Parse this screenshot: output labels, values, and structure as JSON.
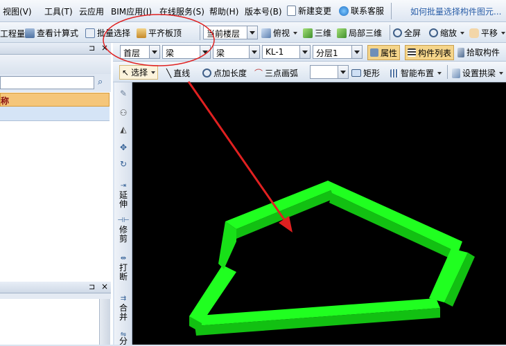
{
  "menubar": {
    "items": [
      "视图(V)",
      "工具(T)",
      "云应用",
      "BIM应用(I)",
      "在线服务(S)",
      "帮助(H)",
      "版本号(B)"
    ],
    "new_change": "新建变更",
    "support": "联系客服",
    "hint": "如何批量选择构件图元..."
  },
  "toolbar1": {
    "items": [
      "工程量",
      "查看计算式",
      "批量选择",
      "平齐板顶"
    ],
    "floor_scope": "当前楼层",
    "view_items": [
      "俯视",
      "三维",
      "局部三维",
      "全屏",
      "缩放",
      "平移"
    ]
  },
  "toolbar2": {
    "floor": "首层",
    "category": "梁",
    "type": "梁",
    "component": "KL-1",
    "sublayer": "分层1",
    "properties": "属性",
    "component_list": "构件列表",
    "pick": "拾取构件"
  },
  "toolbar3": {
    "select": "选择",
    "line": "直线",
    "point_length": "点加长度",
    "arc": "三点画弧",
    "rect": "矩形",
    "smart_layout": "智能布置",
    "set_arch_beam": "设置拱梁"
  },
  "leftpanel": {
    "name_column": "称",
    "pin_symbol": "⊐",
    "close_symbol": "×"
  },
  "vtoolbar": {
    "extend": "延伸",
    "trim": "修剪",
    "break": "打断",
    "merge": "合并",
    "split": "分"
  },
  "colors": {
    "beam_green": "#1aff1a",
    "highlight_orange": "#f5c67a",
    "annotation_red": "#e02020",
    "viewport_bg": "#000000"
  }
}
